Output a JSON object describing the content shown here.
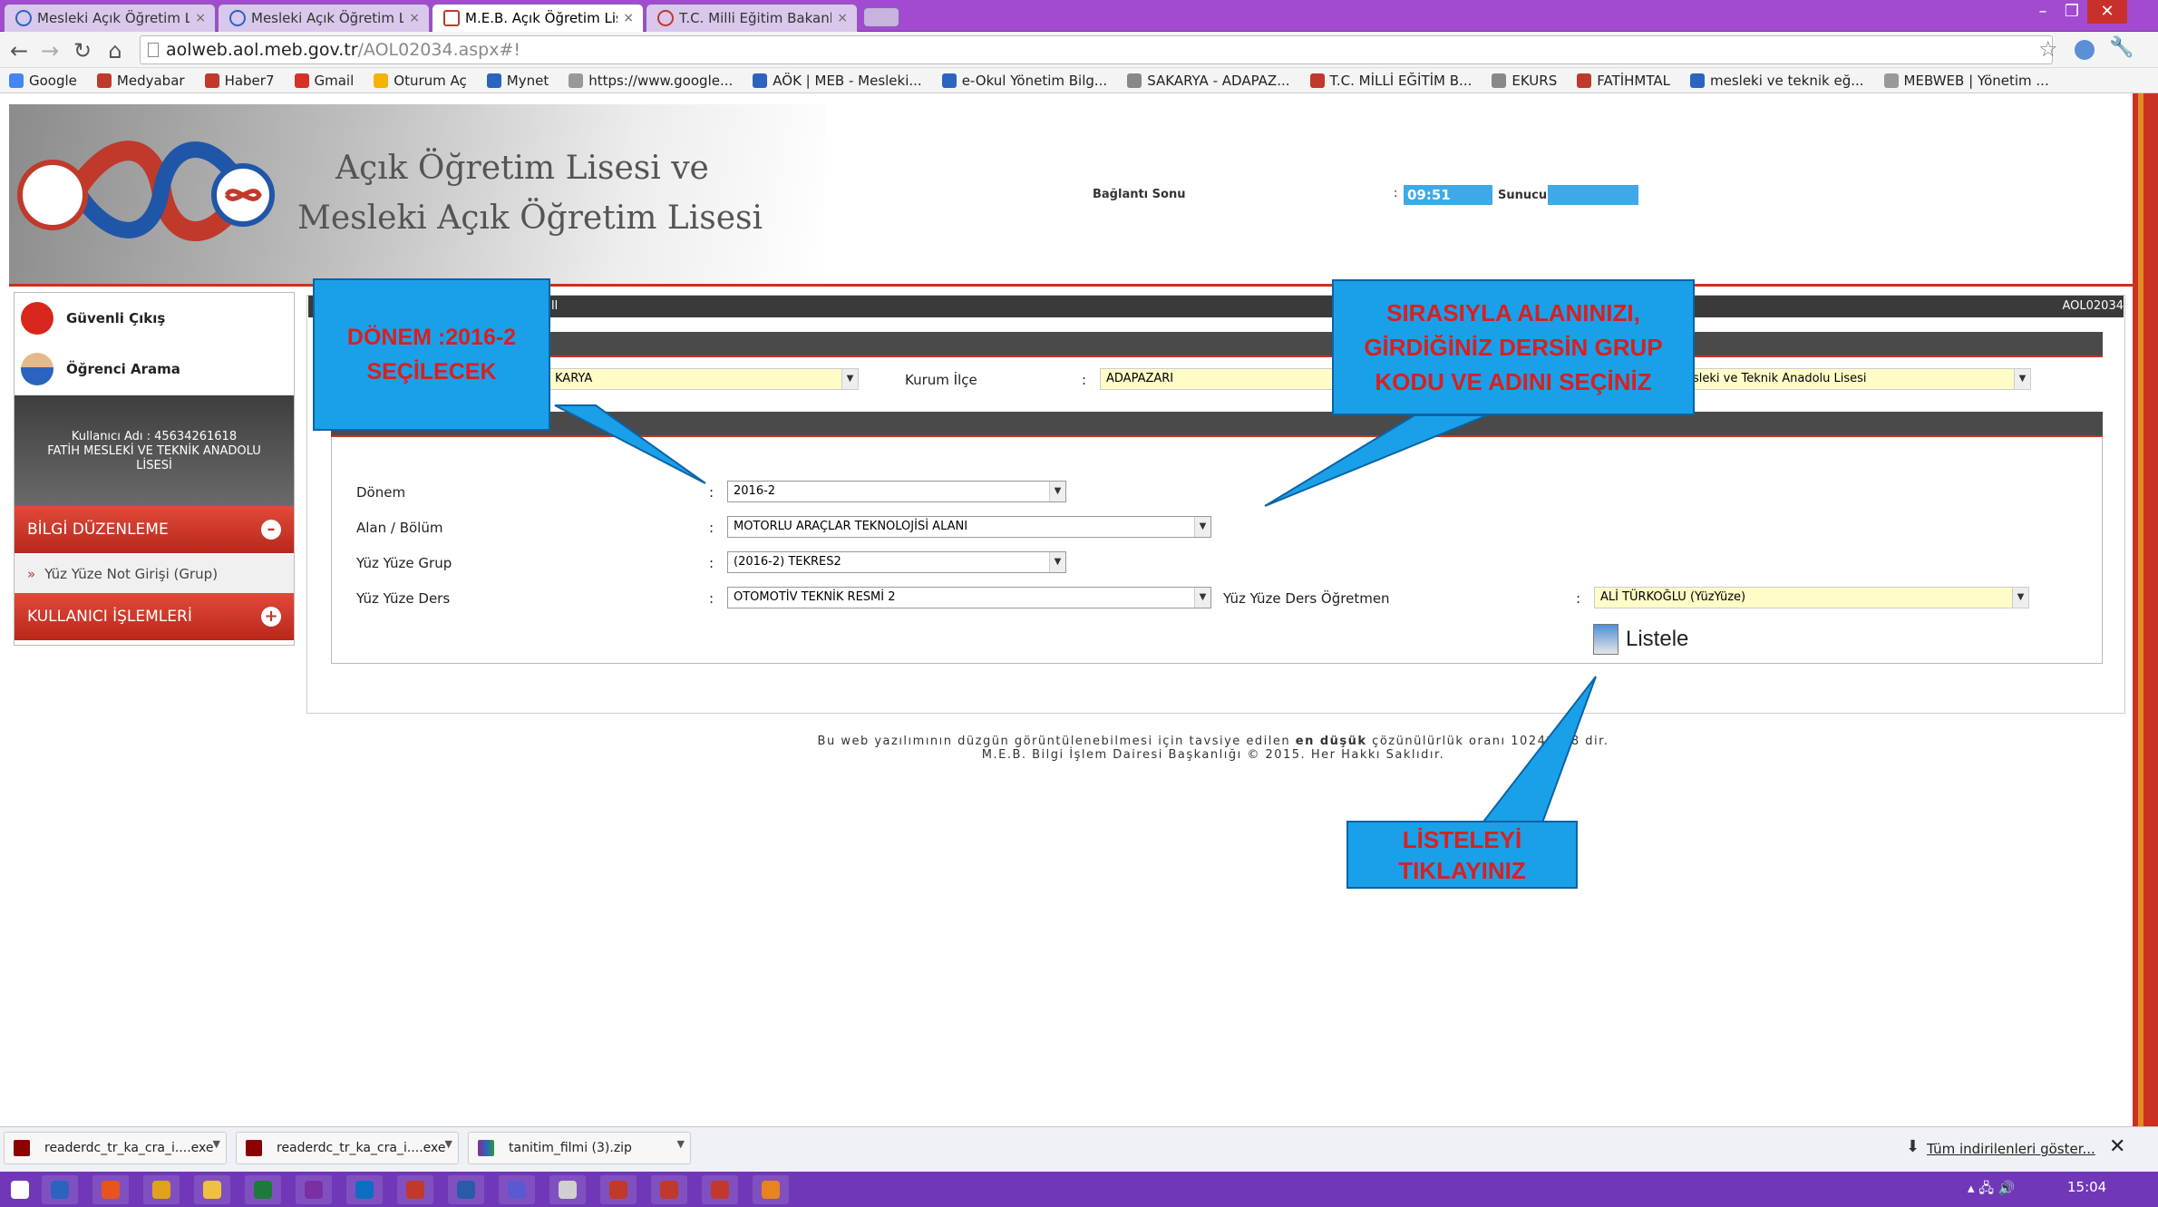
{
  "browser": {
    "tabs": [
      {
        "label": "Mesleki Açık Öğretim Lisesi",
        "active": false
      },
      {
        "label": "Mesleki Açık Öğretim Lisesi",
        "active": false
      },
      {
        "label": "M.E.B. Açık Öğretim Lisesi",
        "active": true
      },
      {
        "label": "T.C. Milli Eğitim Bakanlığı",
        "active": false
      }
    ],
    "tab_close": "×",
    "url_host": "aolweb.aol.meb.gov.tr",
    "url_path": "/AOL02034.aspx#!",
    "window_controls": [
      "–",
      "❐",
      "✕"
    ],
    "bookmarks": [
      {
        "label": "Google",
        "color": "#4285f4"
      },
      {
        "label": "Medyabar",
        "color": "#c0392b"
      },
      {
        "label": "Haber7",
        "color": "#c0392b"
      },
      {
        "label": "Gmail",
        "color": "#d93025"
      },
      {
        "label": "Oturum Aç",
        "color": "#f4b400"
      },
      {
        "label": "Mynet",
        "color": "#2a64c0"
      },
      {
        "label": "https://www.google...",
        "color": "#999999"
      },
      {
        "label": "AÖK | MEB - Mesleki...",
        "color": "#2a64c0"
      },
      {
        "label": "e-Okul Yönetim Bilg...",
        "color": "#2a64c0"
      },
      {
        "label": "SAKARYA - ADAPAZ...",
        "color": "#888888"
      },
      {
        "label": "T.C. MİLLİ EĞİTİM B...",
        "color": "#c0392b"
      },
      {
        "label": "EKURS",
        "color": "#888888"
      },
      {
        "label": "FATİHMTAL",
        "color": "#c0392b"
      },
      {
        "label": "mesleki ve teknik eğ...",
        "color": "#2a64c0"
      },
      {
        "label": "MEBWEB | Yönetim ...",
        "color": "#999999"
      }
    ]
  },
  "header": {
    "title_line1": "Açık Öğretim Lisesi ve",
    "title_line2": "Mesleki Açık Öğretim Lisesi",
    "session_label": "Bağlantı Sonu",
    "session_time": "09:51",
    "server_label": "Sunucu :",
    "colon": ":"
  },
  "sidebar": {
    "logout": "Güvenli Çıkış",
    "student_search": "Öğrenci Arama",
    "user_line1": "Kullanıcı Adı : 45634261618",
    "user_line2": "FATİH MESLEKİ VE TEKNİK ANADOLU",
    "user_line3": "LİSESİ",
    "section1": "BİLGİ DÜZENLEME",
    "section1_toggle": "–",
    "subitem": "Yüz Yüze Not Girişi (Grup)",
    "subitem_arrow": "»",
    "section2": "KULLANICI İŞLEMLERİ",
    "section2_toggle": "+"
  },
  "main": {
    "dark_bar_fragment": "ll",
    "page_code": "AOL02034",
    "filters": {
      "il_value": "KARYA",
      "ilce_label": "Kurum İlçe",
      "ilce_value": "ADAPAZARI",
      "kurum_value": "sleki ve Teknik Anadolu Lisesi"
    },
    "form": {
      "donem_label": "Dönem",
      "donem_value": "2016-2",
      "alan_label": "Alan / Bölüm",
      "alan_value": "MOTORLU ARAÇLAR TEKNOLOJİSİ ALANI",
      "grup_label": "Yüz Yüze Grup",
      "grup_value": "(2016-2) TEKRES2",
      "ders_label": "Yüz Yüze Ders",
      "ders_value": "OTOMOTİV TEKNİK RESMİ 2",
      "ogretmen_label": "Yüz Yüze Ders Öğretmen",
      "ogretmen_value": "ALİ TÜRKOĞLU (YüzYüze)",
      "colon": ":"
    },
    "listele_label": "Listele"
  },
  "callouts": {
    "donem_line1": "DÖNEM :2016-2",
    "donem_line2": "SEÇİLECEK",
    "alan_line1": "SIRASIYLA ALANINIZI,",
    "alan_line2": "GİRDİĞİNİZ DERSİN GRUP",
    "alan_line3": "KODU VE ADINI SEÇİNİZ",
    "listele_line1": "LİSTELEYİ",
    "listele_line2": "TIKLAYINIZ"
  },
  "footer": {
    "line1_pre": "Bu web yazılımının düzgün görüntülenebilmesi için tavsiye edilen ",
    "line1_bold": "en düşük",
    "line1_post": " çözünülürlük oranı 1024*768 dir.",
    "line2": "M.E.B. Bilgi İşlem Dairesi Başkanlığı © 2015. Her Hakkı Saklıdır."
  },
  "downloads": {
    "items": [
      "readerdc_tr_ka_cra_i....exe",
      "readerdc_tr_ka_cra_i....exe",
      "tanitim_filmi (3).zip"
    ],
    "show_all": "Tüm indirilenleri göster...",
    "close": "✕"
  },
  "taskbar": {
    "clock": "15:04",
    "icon_colors": [
      "#ffffff",
      "#2a64c0",
      "#e8541e",
      "#e0a21e",
      "#f0c040",
      "#1e7a3c",
      "#7b2fa5",
      "#0a6fc2",
      "#c0392b",
      "#2a5aa8",
      "#5a5ad0",
      "#d0d0d0",
      "#c0392b",
      "#c0392b",
      "#c0392b",
      "#e8841e"
    ]
  }
}
